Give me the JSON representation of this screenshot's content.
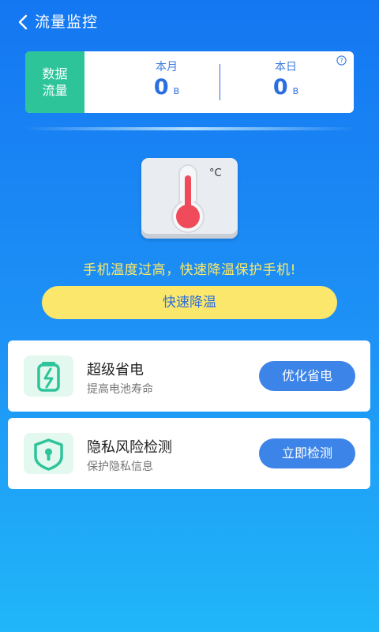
{
  "header": {
    "title": "流量监控",
    "back_icon": "chevron-left-icon"
  },
  "traffic": {
    "label_line1": "数据",
    "label_line2": "流量",
    "month_label": "本月",
    "month_value": "0",
    "month_unit": "B",
    "day_label": "本日",
    "day_value": "0",
    "day_unit": "B",
    "help_icon": "question-circle-icon",
    "accent_color": "#2ec49a"
  },
  "temperature": {
    "unit": "°C",
    "warning": "手机温度过高，快速降温保护手机!",
    "cool_button": "快速降温"
  },
  "features": [
    {
      "title": "超级省电",
      "subtitle": "提高电池寿命",
      "button": "优化省电",
      "icon": "battery-charge-icon"
    },
    {
      "title": "隐私风险检测",
      "subtitle": "保护隐私信息",
      "button": "立即检测",
      "icon": "shield-lock-icon"
    }
  ]
}
